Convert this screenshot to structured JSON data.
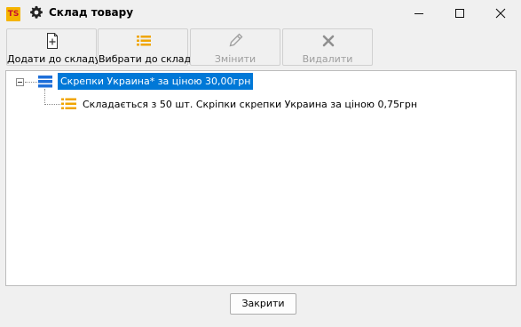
{
  "window": {
    "logo_text": "TS",
    "title": "Склад товару"
  },
  "toolbar": {
    "add_label": "Додати до складу",
    "select_label": "Вибрати до складу",
    "edit_label": "Змінити",
    "delete_label": "Видалити"
  },
  "tree": {
    "nodes": [
      {
        "label": "Скрепки Украина* за ціною 30,00грн",
        "selected": true,
        "expanded": true,
        "children": [
          {
            "label": "Складається з 50 шт. Скріпки скрепки Украина за ціною 0,75грн"
          }
        ]
      }
    ]
  },
  "footer": {
    "close_label": "Закрити"
  },
  "colors": {
    "selection": "#0078d7",
    "list_icon": "#f0a500",
    "product_icon": "#1e6fd9",
    "disabled_text": "#9e9e9e"
  }
}
